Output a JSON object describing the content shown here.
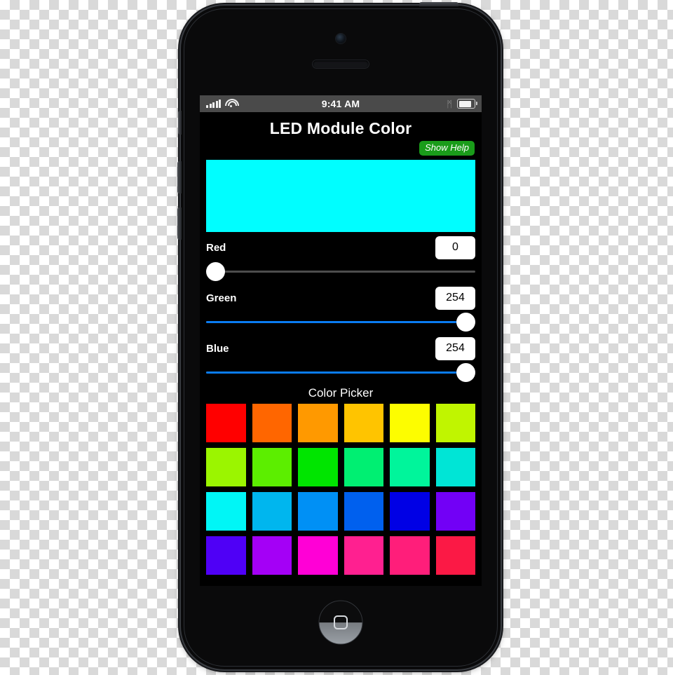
{
  "status_bar": {
    "carrier_signal_icon": "signal-bars-icon",
    "wifi_icon": "wifi-icon",
    "time": "9:41 AM",
    "bluetooth_icon": "bluetooth-icon",
    "bluetooth_glyph": "ᛗ",
    "battery_icon": "battery-icon"
  },
  "app": {
    "title": "LED Module Color",
    "help_button": "Show Help",
    "help_button_color": "#1a9c1a",
    "preview_color": "#00feff",
    "channels": [
      {
        "label": "Red",
        "value": "0",
        "percent": 0
      },
      {
        "label": "Green",
        "value": "254",
        "percent": 100
      },
      {
        "label": "Blue",
        "value": "254",
        "percent": 100
      }
    ],
    "picker": {
      "title": "Color Picker",
      "rows": [
        [
          "#ff0000",
          "#ff6600",
          "#ff9900",
          "#ffc400",
          "#fdfd00",
          "#c0f500"
        ],
        [
          "#9bf500",
          "#5cee00",
          "#00e500",
          "#00ef72",
          "#00f59b",
          "#00e5d6"
        ],
        [
          "#00f6f6",
          "#00b6ee",
          "#0090f5",
          "#0060ee",
          "#0000e5",
          "#7200f6"
        ],
        [
          "#4f00f6",
          "#a400f6",
          "#ff00d6",
          "#ff2090",
          "#ff1e7a",
          "#fb1945"
        ]
      ]
    }
  },
  "device": {
    "home_button_icon": "home-square-icon",
    "camera_icon": "front-camera-icon",
    "speaker_icon": "earpiece-speaker-icon"
  }
}
